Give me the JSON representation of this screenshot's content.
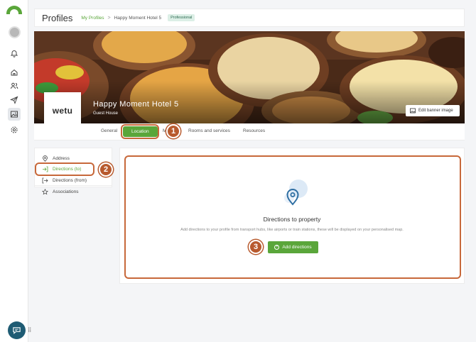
{
  "header": {
    "title": "Profiles",
    "breadcrumb_link": "My Profiles",
    "breadcrumb_sep": ">",
    "breadcrumb_current": "Happy Moment Hotel 5",
    "badge": "Professional"
  },
  "banner": {
    "hotel_name": "Happy Moment Hotel 5",
    "hotel_type": "Guest House",
    "edit_label": "Edit banner image",
    "logo_text": "wetu"
  },
  "tabs": {
    "general": "General",
    "location": "Location",
    "media_partial": "M",
    "rooms": "Rooms and services",
    "resources": "Resources"
  },
  "sidenav": {
    "address": "Address",
    "directions_to": "Directions (to)",
    "directions_from": "Directions (from)",
    "associations": "Associations"
  },
  "main": {
    "empty_title": "Directions to property",
    "empty_desc": "Add directions to your profile from transport hubs, like airports or train stations, these will be displayed on your personalised map.",
    "add_button": "Add directions"
  },
  "steps": {
    "one": "1",
    "two": "2",
    "three": "3"
  },
  "colors": {
    "accent": "#5aa63a",
    "annotation": "#c7683a",
    "chat": "#1f5c74",
    "pin": "#2f6fa3"
  },
  "icons": [
    "home-icon",
    "users-icon",
    "send-icon",
    "image-icon",
    "settings-icon",
    "bell-icon",
    "map-pin-icon",
    "chat-icon"
  ]
}
